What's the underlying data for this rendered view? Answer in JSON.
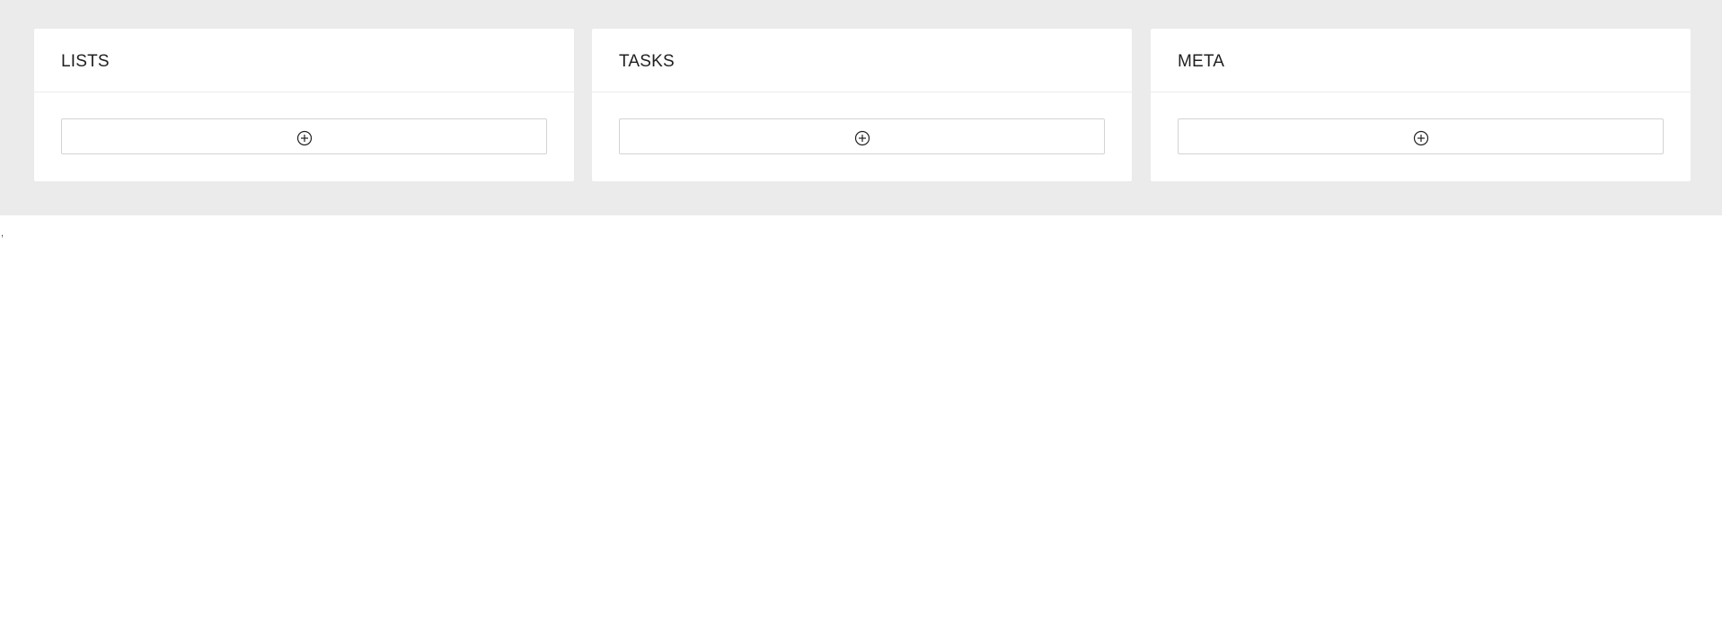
{
  "board": {
    "columns": [
      {
        "title": "LISTS",
        "add_icon": "plus-circle-icon"
      },
      {
        "title": "TASKS",
        "add_icon": "plus-circle-icon"
      },
      {
        "title": "META",
        "add_icon": "plus-circle-icon"
      }
    ]
  },
  "stray_text": ",",
  "colors": {
    "board_background": "#ebebeb",
    "panel_background": "#ffffff",
    "button_border": "#d3d3d3",
    "divider": "#ececec"
  }
}
